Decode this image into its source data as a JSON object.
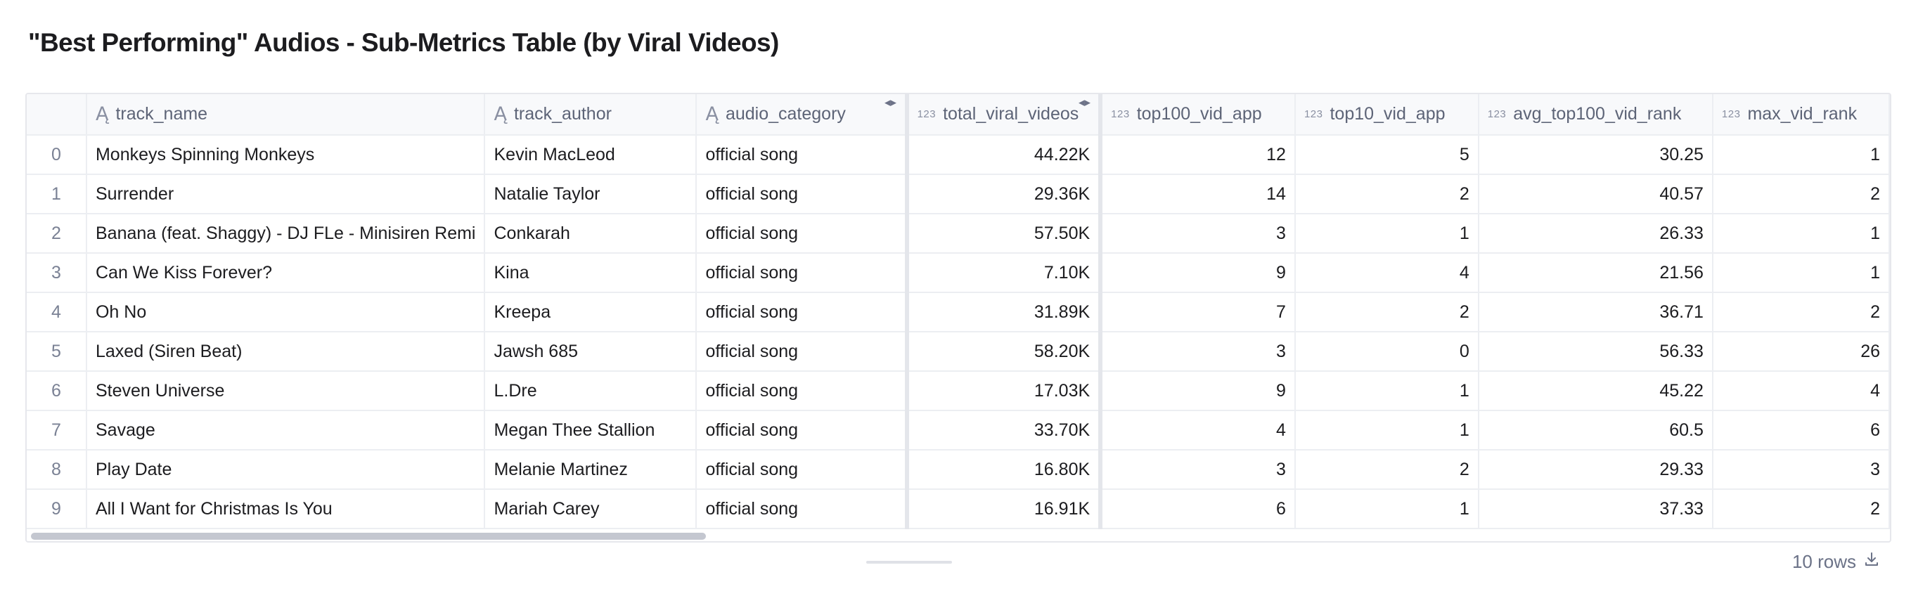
{
  "title": "\"Best Performing\" Audios - Sub-Metrics Table (by Viral Videos)",
  "columns": [
    {
      "name": "track_name",
      "type_icon": "A",
      "type": "text"
    },
    {
      "name": "track_author",
      "type_icon": "A",
      "type": "text"
    },
    {
      "name": "audio_category",
      "type_icon": "A",
      "type": "text"
    },
    {
      "name": "total_viral_videos",
      "type_icon": "123",
      "type": "number"
    },
    {
      "name": "top100_vid_app",
      "type_icon": "123",
      "type": "number"
    },
    {
      "name": "top10_vid_app",
      "type_icon": "123",
      "type": "number"
    },
    {
      "name": "avg_top100_vid_rank",
      "type_icon": "123",
      "type": "number"
    },
    {
      "name": "max_vid_rank",
      "type_icon": "123",
      "type": "number"
    }
  ],
  "rows": [
    {
      "idx": "0",
      "track_name": "Monkeys Spinning Monkeys",
      "track_author": "Kevin MacLeod",
      "audio_category": "official song",
      "total_viral_videos": "44.22K",
      "top100_vid_app": "12",
      "top10_vid_app": "5",
      "avg_top100_vid_rank": "30.25",
      "max_vid_rank": "1"
    },
    {
      "idx": "1",
      "track_name": "Surrender",
      "track_author": "Natalie Taylor",
      "audio_category": "official song",
      "total_viral_videos": "29.36K",
      "top100_vid_app": "14",
      "top10_vid_app": "2",
      "avg_top100_vid_rank": "40.57",
      "max_vid_rank": "2"
    },
    {
      "idx": "2",
      "track_name": "Banana (feat. Shaggy) - DJ FLe - Minisiren Remi",
      "track_author": "Conkarah",
      "audio_category": "official song",
      "total_viral_videos": "57.50K",
      "top100_vid_app": "3",
      "top10_vid_app": "1",
      "avg_top100_vid_rank": "26.33",
      "max_vid_rank": "1"
    },
    {
      "idx": "3",
      "track_name": "Can We Kiss Forever?",
      "track_author": "Kina",
      "audio_category": "official song",
      "total_viral_videos": "7.10K",
      "top100_vid_app": "9",
      "top10_vid_app": "4",
      "avg_top100_vid_rank": "21.56",
      "max_vid_rank": "1"
    },
    {
      "idx": "4",
      "track_name": "Oh No",
      "track_author": "Kreepa",
      "audio_category": "official song",
      "total_viral_videos": "31.89K",
      "top100_vid_app": "7",
      "top10_vid_app": "2",
      "avg_top100_vid_rank": "36.71",
      "max_vid_rank": "2"
    },
    {
      "idx": "5",
      "track_name": "Laxed (Siren Beat)",
      "track_author": "Jawsh 685",
      "audio_category": "official song",
      "total_viral_videos": "58.20K",
      "top100_vid_app": "3",
      "top10_vid_app": "0",
      "avg_top100_vid_rank": "56.33",
      "max_vid_rank": "26"
    },
    {
      "idx": "6",
      "track_name": "Steven Universe",
      "track_author": "L.Dre",
      "audio_category": "official song",
      "total_viral_videos": "17.03K",
      "top100_vid_app": "9",
      "top10_vid_app": "1",
      "avg_top100_vid_rank": "45.22",
      "max_vid_rank": "4"
    },
    {
      "idx": "7",
      "track_name": "Savage",
      "track_author": "Megan Thee Stallion",
      "audio_category": "official song",
      "total_viral_videos": "33.70K",
      "top100_vid_app": "4",
      "top10_vid_app": "1",
      "avg_top100_vid_rank": "60.5",
      "max_vid_rank": "6"
    },
    {
      "idx": "8",
      "track_name": "Play Date",
      "track_author": "Melanie Martinez",
      "audio_category": "official song",
      "total_viral_videos": "16.80K",
      "top100_vid_app": "3",
      "top10_vid_app": "2",
      "avg_top100_vid_rank": "29.33",
      "max_vid_rank": "3"
    },
    {
      "idx": "9",
      "track_name": "All I Want for Christmas Is You",
      "track_author": "Mariah Carey",
      "audio_category": "official song",
      "total_viral_videos": "16.91K",
      "top100_vid_app": "6",
      "top10_vid_app": "1",
      "avg_top100_vid_rank": "37.33",
      "max_vid_rank": "2"
    }
  ],
  "footer": {
    "row_count_label": "10 rows",
    "download_icon": "download-icon"
  }
}
